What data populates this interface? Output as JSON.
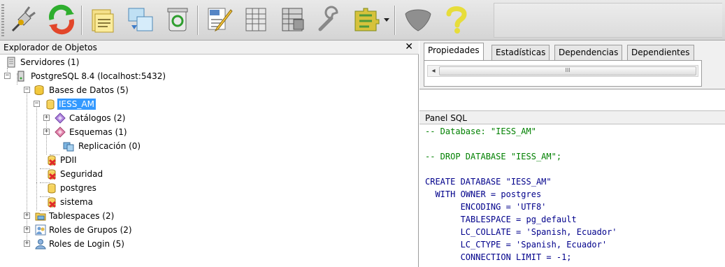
{
  "toolbar": {
    "buttons": [
      {
        "name": "connect-plug-icon"
      },
      {
        "name": "refresh-icon"
      },
      {
        "name": "properties-folder-icon"
      },
      {
        "name": "create-object-icon"
      },
      {
        "name": "delete-recycle-icon"
      },
      {
        "name": "sql-editor-icon"
      },
      {
        "name": "view-data-grid-icon"
      },
      {
        "name": "filtered-data-grid-icon"
      },
      {
        "name": "maintenance-wrench-icon"
      },
      {
        "name": "plugins-puzzle-icon"
      },
      {
        "name": "hint-shield-icon"
      },
      {
        "name": "help-question-icon"
      }
    ]
  },
  "left_panel": {
    "title": "Explorador de Objetos",
    "close": "✕"
  },
  "tree": {
    "nodes": [
      {
        "label": "Servidores (1)",
        "icon": "servers-icon"
      },
      {
        "label": "PostgreSQL 8.4 (localhost:5432)",
        "icon": "server-icon"
      },
      {
        "label": "Bases de Datos (5)",
        "icon": "databases-icon"
      },
      {
        "label": "IESS_AM",
        "icon": "database-icon",
        "selected": true
      },
      {
        "label": "Catálogos (2)",
        "icon": "catalogs-icon"
      },
      {
        "label": "Esquemas (1)",
        "icon": "schemas-icon"
      },
      {
        "label": "Replicación (0)",
        "icon": "replication-icon"
      },
      {
        "label": "PDII",
        "icon": "database-disconnected-icon"
      },
      {
        "label": "Seguridad",
        "icon": "database-disconnected-icon"
      },
      {
        "label": "postgres",
        "icon": "database-icon"
      },
      {
        "label": "sistema",
        "icon": "database-disconnected-icon"
      },
      {
        "label": "Tablespaces (2)",
        "icon": "tablespaces-icon"
      },
      {
        "label": "Roles de Grupos (2)",
        "icon": "group-roles-icon"
      },
      {
        "label": "Roles de Login (5)",
        "icon": "login-roles-icon"
      }
    ]
  },
  "right_panel": {
    "tabs": [
      "Propiedades",
      "Estadísticas",
      "Dependencias",
      "Dependientes"
    ],
    "active_tab": "Propiedades",
    "scroll_left": "◂",
    "scroll_grip": "III",
    "sql_panel_title": "Panel SQL",
    "sql_lines": [
      "-- Database: \"IESS_AM\"",
      "",
      "-- DROP DATABASE \"IESS_AM\";",
      "",
      "CREATE DATABASE \"IESS_AM\"",
      "  WITH OWNER = postgres",
      "       ENCODING = 'UTF8'",
      "       TABLESPACE = pg_default",
      "       LC_COLLATE = 'Spanish, Ecuador'",
      "       LC_CTYPE = 'Spanish, Ecuador'",
      "       CONNECTION LIMIT = -1;"
    ]
  },
  "colors": {
    "selection": "#3399ff",
    "sql_keyword": "#00008b",
    "sql_comment": "#008000",
    "sql_string": "#a31515"
  }
}
